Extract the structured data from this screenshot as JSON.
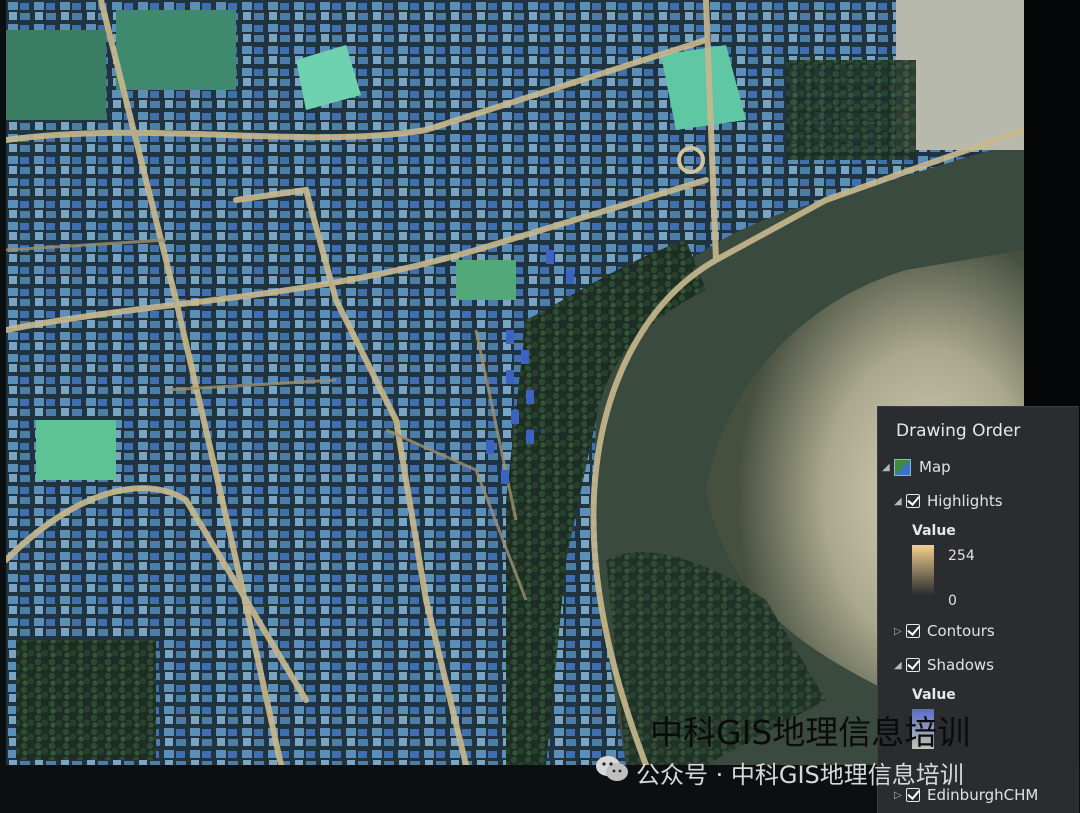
{
  "panel": {
    "title": "Drawing Order",
    "map_label": "Map",
    "layers": [
      {
        "label": "Highlights",
        "checked": true,
        "expanded": true,
        "value_title": "Value",
        "max": "254",
        "min": "0"
      },
      {
        "label": "Contours",
        "checked": true,
        "expanded": false
      },
      {
        "label": "Shadows",
        "checked": true,
        "expanded": true,
        "value_title": "Value"
      },
      {
        "label": "EdinburghCHM",
        "checked": true,
        "expanded": false
      }
    ]
  },
  "watermark": {
    "main": "中科GIS地理信息培训",
    "sub": "公众号 · 中科GIS地理信息培训"
  },
  "colors": {
    "panel_bg": "#2a2c30",
    "highlight_ramp_top": "#f3cf8e",
    "highlight_ramp_bottom": "#2a2c30"
  }
}
